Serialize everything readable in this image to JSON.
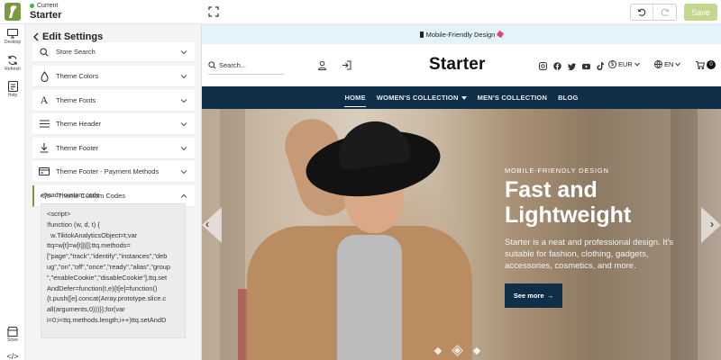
{
  "app": {
    "status_label": "Current",
    "store_name": "Starter",
    "save_label": "Save",
    "accent_color": "#7a9a3c"
  },
  "rail": {
    "items": [
      {
        "label": "Desktop",
        "icon": "desktop-icon"
      },
      {
        "label": "Refresh",
        "icon": "refresh-icon"
      },
      {
        "label": "Help",
        "icon": "help-icon"
      },
      {
        "label": "Store",
        "icon": "store-icon"
      }
    ]
  },
  "panel": {
    "title": "Edit Settings",
    "items": [
      {
        "label": "Store Search",
        "icon": "search-icon"
      },
      {
        "label": "Theme Colors",
        "icon": "droplet-icon"
      },
      {
        "label": "Theme Fonts",
        "icon": "font-icon"
      },
      {
        "label": "Theme Header",
        "icon": "menu-icon"
      },
      {
        "label": "Theme Footer",
        "icon": "download-icon"
      },
      {
        "label": "Theme Footer - Payment Methods",
        "icon": "credit-card-icon"
      },
      {
        "label": "Theme Custom Codes",
        "icon": "code-icon"
      }
    ],
    "code_label": "<head> custom code",
    "code_value": "<script>\n!function (w, d, t) {\n  w.TiktokAnalyticsObject=t;var\nttq=w[t]=w[t]||[];ttq.methods=\n[\"page\",\"track\",\"identify\",\"instances\",\"deb\nug\",\"on\",\"off\",\"once\",\"ready\",\"alias\",\"group\n\",\"enableCookie\",\"disableCookie\"],ttq.set\nAndDefer=function(t,e){t[e]=function()\n{t.push([e].concat(Array.prototype.slice.c\nall(arguments,0)))}};for(var\ni=0;i<ttq.methods.length;i++)ttq.setAndD"
  },
  "preview": {
    "announcement": "Mobile-Friendly Design",
    "search_label": "Search...",
    "brand": "Starter",
    "currency": "EUR",
    "language": "EN",
    "cart_count": "0",
    "nav": [
      {
        "label": "HOME"
      },
      {
        "label": "WOMEN'S COLLECTION"
      },
      {
        "label": "MEN'S COLLECTION"
      },
      {
        "label": "BLOG"
      }
    ],
    "hero": {
      "eyebrow": "MOBILE-FRIENDLY DESIGN",
      "title": "Fast and Lightweight",
      "description": "Starter is a neat and professional design. It's suitable for fashion, clothing, gadgets, accessories, cosmetics, and more.",
      "button": "See more"
    },
    "nav_color": "#0f2e48",
    "announce_color": "#e4f3fa"
  }
}
